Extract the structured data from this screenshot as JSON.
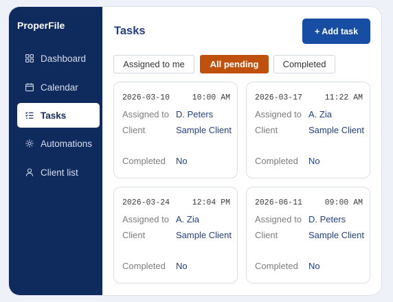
{
  "sidebar": {
    "brand": "ProperFile",
    "items": [
      {
        "label": "Dashboard",
        "icon": "grid-icon"
      },
      {
        "label": "Calendar",
        "icon": "calendar-icon"
      },
      {
        "label": "Tasks",
        "icon": "list-icon",
        "active": true
      },
      {
        "label": "Automations",
        "icon": "gear-icon"
      },
      {
        "label": "Client list",
        "icon": "user-icon"
      }
    ]
  },
  "header": {
    "title": "Tasks",
    "add_label": "+ Add task"
  },
  "filters": [
    {
      "label": "Assigned to me"
    },
    {
      "label": "All pending",
      "active": true
    },
    {
      "label": "Completed"
    }
  ],
  "fields": {
    "assigned": "Assigned to",
    "client": "Client",
    "completed": "Completed"
  },
  "tasks": [
    {
      "date": "2026-03-10",
      "time": "10:00 AM",
      "assigned": "D. Peters",
      "client": "Sample Client",
      "completed": "No"
    },
    {
      "date": "2026-03-17",
      "time": "11:22 AM",
      "assigned": "A. Zia",
      "client": "Sample Client",
      "completed": "No"
    },
    {
      "date": "2026-03-24",
      "time": "12:04 PM",
      "assigned": "A. Zia",
      "client": "Sample Client",
      "completed": "No"
    },
    {
      "date": "2026-06-11",
      "time": "09:00 AM",
      "assigned": "D. Peters",
      "client": "Sample Client",
      "completed": "No"
    }
  ],
  "colors": {
    "sidebar": "#0f2a5c",
    "accent": "#174ea3",
    "active_filter": "#c0500e",
    "link_text": "#1f3f80"
  }
}
